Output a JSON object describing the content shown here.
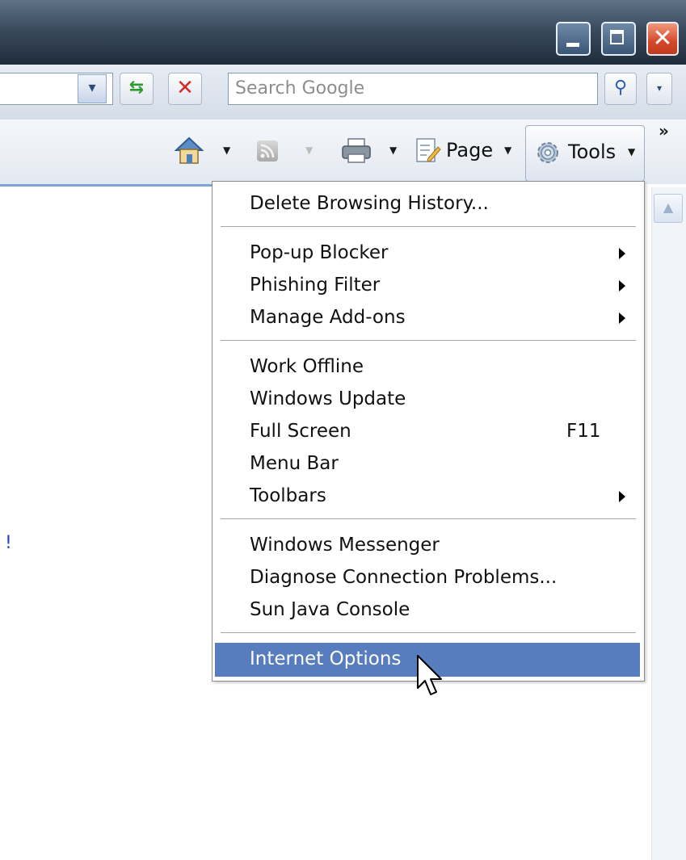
{
  "window": {
    "minimize_glyph": "",
    "maximize_glyph": "",
    "close_glyph": "✕"
  },
  "navbar": {
    "address_value": "",
    "refresh_glyph": "⇆",
    "stop_glyph": "✕",
    "search_placeholder": "Search Google",
    "search_go_glyph": "⚲",
    "dropdown_glyph": "▾"
  },
  "command_bar": {
    "home_icon": "home-icon",
    "feeds_icon": "rss-feed-icon",
    "print_icon": "printer-icon",
    "page_icon": "page-icon",
    "page_label": "Page",
    "tools_icon": "gear-icon",
    "tools_label": "Tools",
    "caret_glyph": "▼",
    "chevron_glyph": "»"
  },
  "page": {
    "fragment_text": "!"
  },
  "tools_menu": {
    "items": [
      {
        "label": "Delete Browsing History..."
      },
      {
        "label": "Pop-up Blocker",
        "submenu": true
      },
      {
        "label": "Phishing Filter",
        "submenu": true
      },
      {
        "label": "Manage Add-ons",
        "submenu": true
      },
      {
        "label": "Work Offline"
      },
      {
        "label": "Windows Update"
      },
      {
        "label": "Full Screen",
        "shortcut": "F11"
      },
      {
        "label": "Menu Bar"
      },
      {
        "label": "Toolbars",
        "submenu": true
      },
      {
        "label": "Windows Messenger"
      },
      {
        "label": "Diagnose Connection Problems..."
      },
      {
        "label": "Sun Java Console"
      },
      {
        "label": "Internet Options",
        "highlighted": true
      }
    ]
  },
  "colors": {
    "menu_highlight": "#587dbf",
    "title_bar": "#2b3a4d",
    "close_button": "#d5482a"
  }
}
